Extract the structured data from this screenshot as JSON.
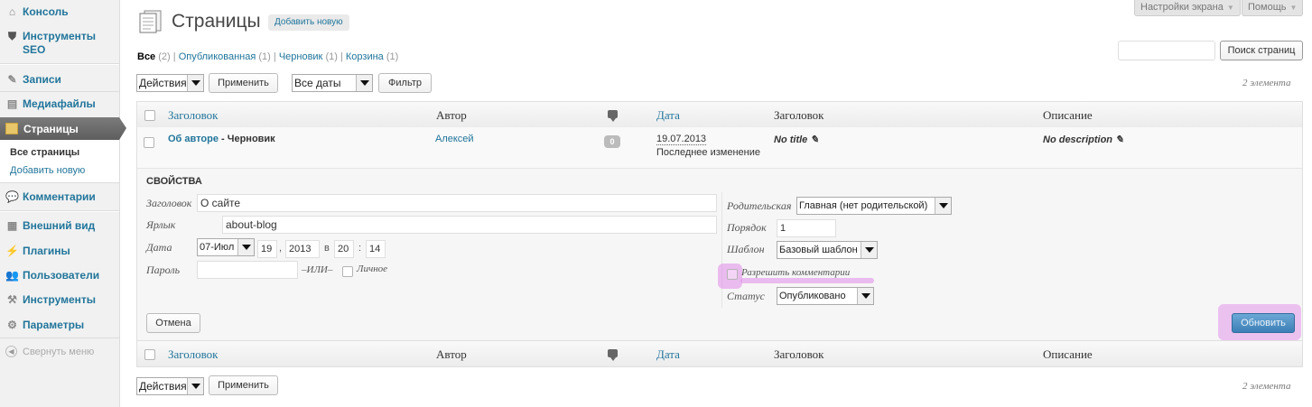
{
  "sidebar": {
    "items": [
      {
        "label": "Консоль",
        "icon": "home-icon"
      },
      {
        "label": "Инструменты SEO",
        "icon": "shield-icon"
      },
      {
        "label": "Записи",
        "icon": "pin-icon"
      },
      {
        "label": "Медиафайлы",
        "icon": "media-icon"
      },
      {
        "label": "Страницы",
        "icon": "pages-icon"
      },
      {
        "label": "Комментарии",
        "icon": "comment-icon"
      },
      {
        "label": "Внешний вид",
        "icon": "appearance-icon"
      },
      {
        "label": "Плагины",
        "icon": "plugin-icon"
      },
      {
        "label": "Пользователи",
        "icon": "users-icon"
      },
      {
        "label": "Инструменты",
        "icon": "tools-icon"
      },
      {
        "label": "Параметры",
        "icon": "settings-icon"
      }
    ],
    "submenu": {
      "all_pages": "Все страницы",
      "add_new": "Добавить новую"
    },
    "collapse": "Свернуть меню"
  },
  "top": {
    "screen_options": "Настройки экрана",
    "help": "Помощь"
  },
  "header": {
    "title": "Страницы",
    "add_new": "Добавить новую"
  },
  "filters": {
    "all": "Все",
    "all_count": "(2)",
    "published": "Опубликованная",
    "published_count": "(1)",
    "draft": "Черновик",
    "draft_count": "(1)",
    "trash": "Корзина",
    "trash_count": "(1)",
    "sep": "|"
  },
  "search": {
    "button": "Поиск страниц",
    "placeholder": ""
  },
  "bulk": {
    "actions": "Действия",
    "apply": "Применить",
    "dates": "Все даты",
    "filter": "Фильтр",
    "count": "2 элемента"
  },
  "table": {
    "columns": {
      "title": "Заголовок",
      "author": "Автор",
      "date": "Дата",
      "seo_title": "Заголовок",
      "description": "Описание"
    }
  },
  "row": {
    "title": "Об авторе",
    "state": " - Черновик",
    "author": "Алексей",
    "comments": "0",
    "date": "19.07.2013",
    "date_note": "Последнее изменение",
    "seo_title": "No title",
    "description": "No description"
  },
  "quick_edit": {
    "heading": "СВОЙСТВА",
    "title_label": "Заголовок",
    "title_value": "О сайте",
    "slug_label": "Ярлык",
    "slug_value": "about-blog",
    "date_label": "Дата",
    "month": "07-Июл",
    "day": "19",
    "comma": ",",
    "year": "2013",
    "at": "в",
    "hour": "20",
    "colon": ":",
    "minute": "14",
    "password_label": "Пароль",
    "or": "–ИЛИ–",
    "private": "Личное",
    "parent_label": "Родительская",
    "parent_value": "Главная (нет родительской)",
    "order_label": "Порядок",
    "order_value": "1",
    "template_label": "Шаблон",
    "template_value": "Базовый шаблон",
    "allow_comments": "Разрешить комментарии",
    "status_label": "Статус",
    "status_value": "Опубликовано",
    "cancel": "Отмена",
    "update": "Обновить"
  },
  "colors": {
    "link": "#21759b",
    "sidebar_bg": "#f1f1f1",
    "current_menu": "#6d6d6d",
    "highlight": "#e08be8"
  }
}
